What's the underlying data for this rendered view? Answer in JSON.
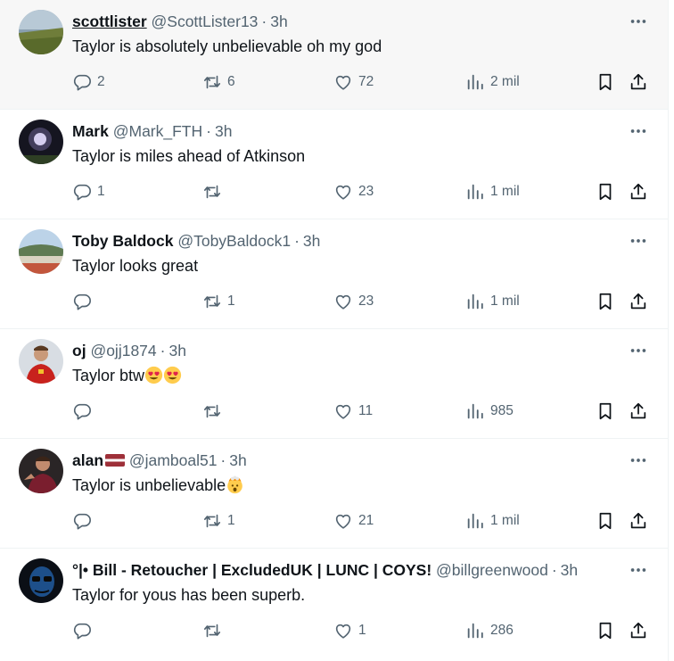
{
  "tweets": [
    {
      "name": "scottlister",
      "handle": "@ScottLister13",
      "time": "3h",
      "text": "Taylor is absolutely unbelievable oh my god",
      "replies": "2",
      "retweets": "6",
      "likes": "72",
      "views": "2 mil"
    },
    {
      "name": "Mark",
      "handle": "@Mark_FTH",
      "time": "3h",
      "text": "Taylor is miles ahead of Atkinson",
      "replies": "1",
      "retweets": "",
      "likes": "23",
      "views": "1 mil"
    },
    {
      "name": "Toby Baldock",
      "handle": "@TobyBaldock1",
      "time": "3h",
      "text": "Taylor looks great",
      "replies": "",
      "retweets": "1",
      "likes": "23",
      "views": "1 mil"
    },
    {
      "name": "oj",
      "handle": "@ojj1874",
      "time": "3h",
      "text": "Taylor btw",
      "replies": "",
      "retweets": "",
      "likes": "11",
      "views": "985"
    },
    {
      "name": "alan",
      "handle": "@jamboal51",
      "time": "3h",
      "text": "Taylor is unbelievable",
      "replies": "",
      "retweets": "1",
      "likes": "21",
      "views": "1 mil"
    },
    {
      "name": "°|• Bill - Retoucher | ExcludedUK | LUNC | COYS!",
      "handle": "@billgreenwood",
      "time": "3h",
      "text": "Taylor for yous has been superb.",
      "replies": "",
      "retweets": "",
      "likes": "1",
      "views": "286"
    }
  ],
  "separator": "·",
  "icons": [
    "reply-icon",
    "retweet-icon",
    "like-icon",
    "views-icon",
    "bookmark-icon",
    "share-icon",
    "more-icon"
  ],
  "colors": {
    "text": "#0f1419",
    "secondary": "#536471",
    "divider": "#eff3f4",
    "hover": "#f7f7f7"
  }
}
